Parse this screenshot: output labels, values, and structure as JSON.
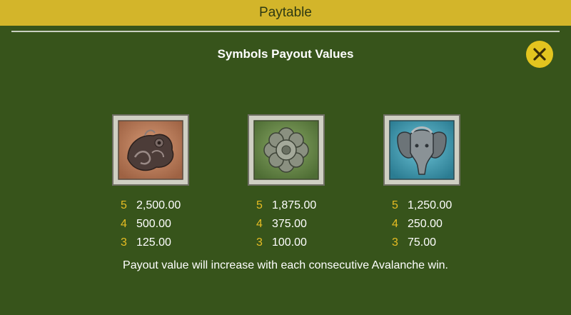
{
  "header": {
    "title": "Paytable"
  },
  "section": {
    "title": "Symbols Payout Values"
  },
  "close": {
    "icon": "close-icon"
  },
  "symbols": [
    {
      "name": "dragon-fish",
      "icon": "dragon-fish-symbol-icon",
      "tile_color": "#b97a58",
      "payouts": [
        {
          "count": "5",
          "value": "2,500.00"
        },
        {
          "count": "4",
          "value": "500.00"
        },
        {
          "count": "3",
          "value": "125.00"
        }
      ]
    },
    {
      "name": "lotus-flower",
      "icon": "lotus-flower-symbol-icon",
      "tile_color": "#6a8a4c",
      "payouts": [
        {
          "count": "5",
          "value": "1,875.00"
        },
        {
          "count": "4",
          "value": "375.00"
        },
        {
          "count": "3",
          "value": "100.00"
        }
      ]
    },
    {
      "name": "elephant",
      "icon": "elephant-symbol-icon",
      "tile_color": "#3f9ab0",
      "payouts": [
        {
          "count": "5",
          "value": "1,250.00"
        },
        {
          "count": "4",
          "value": "250.00"
        },
        {
          "count": "3",
          "value": "75.00"
        }
      ]
    }
  ],
  "footnote": "Payout value will increase with each consecutive Avalanche win.",
  "colors": {
    "background": "#37541b",
    "header": "#d3b52a",
    "accent": "#e7bd23"
  }
}
